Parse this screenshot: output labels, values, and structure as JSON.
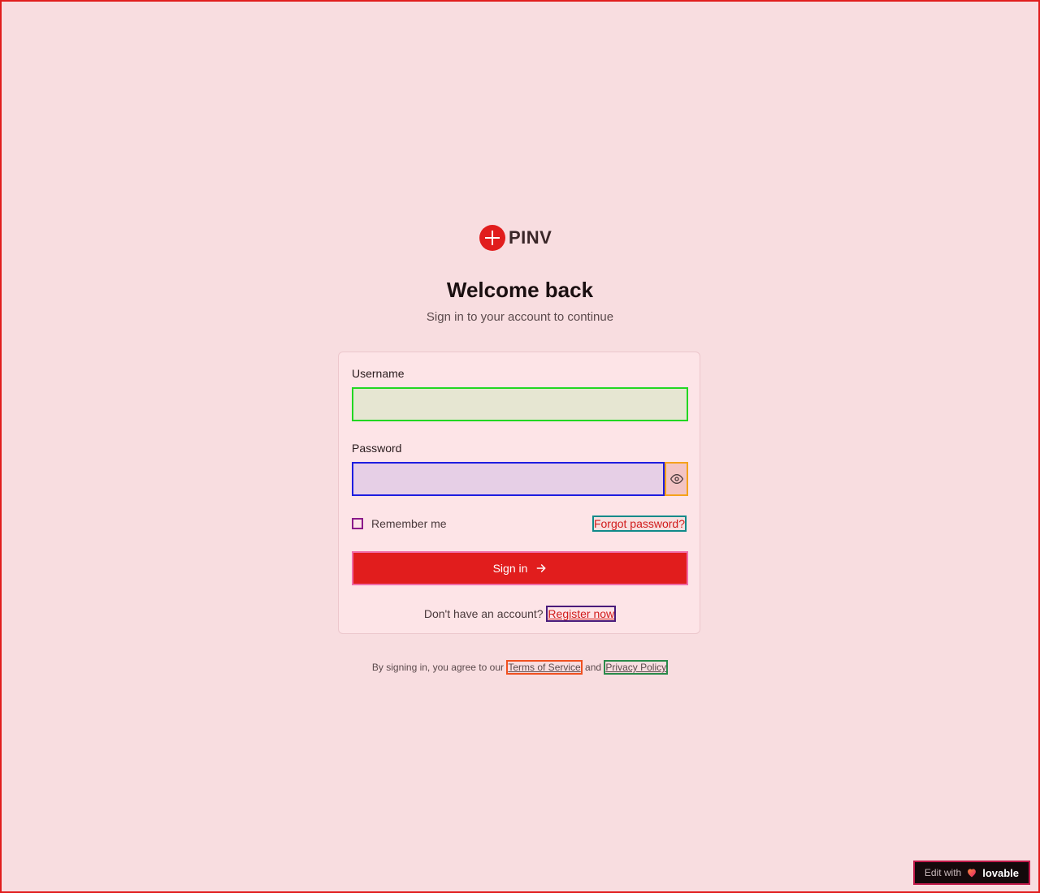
{
  "brand": {
    "name": "PINV",
    "accent": "#e11d1d"
  },
  "header": {
    "title": "Welcome back",
    "subtitle": "Sign in to your account to continue"
  },
  "form": {
    "username_label": "Username",
    "username_value": "",
    "username_placeholder": "",
    "password_label": "Password",
    "password_value": "",
    "password_placeholder": "",
    "toggle_icon": "eye-icon",
    "remember_label": "Remember me",
    "remember_checked": false,
    "forgot_label": "Forgot password?",
    "submit_label": "Sign in",
    "submit_icon": "arrow-right-icon",
    "register_prompt": "Don't have an account?",
    "register_label": "Register now"
  },
  "legal": {
    "prefix": "By signing in, you agree to our",
    "terms_label": "Terms of Service",
    "and": "and",
    "privacy_label": "Privacy Policy"
  },
  "badge": {
    "prefix": "Edit with",
    "brand": "lovable"
  }
}
